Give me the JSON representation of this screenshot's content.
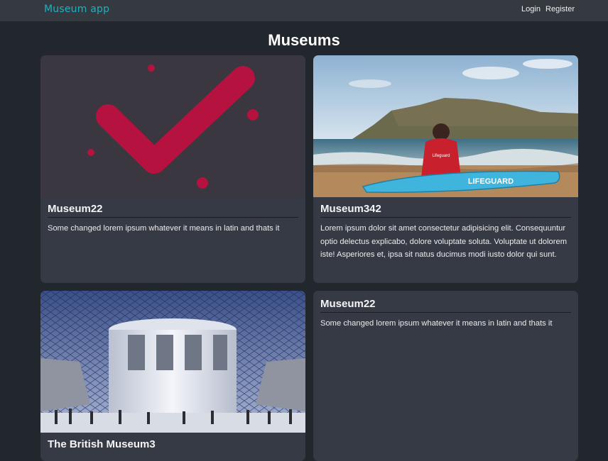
{
  "navbar": {
    "brand": "Museum app",
    "login_label": "Login",
    "register_label": "Register"
  },
  "page_title": "Museums",
  "cards": [
    {
      "image": "checkmark-logo-image",
      "title": "Museum22",
      "description": "Some changed lorem ipsum whatever it means in latin and thats it"
    },
    {
      "image": "lifeguard-beach-photo",
      "title": "Museum342",
      "description": "Lorem ipsum dolor sit amet consectetur adipisicing elit. Consequuntur optio delectus explicabo, dolore voluptate soluta. Voluptate ut dolorem iste! Asperiores et, ipsa sit natus ducimus modi iusto dolor qui sunt.",
      "image_text": {
        "board": "LIFEGUARD",
        "shirt": "Lifeguard"
      }
    },
    {
      "image": "british-museum-great-court-photo",
      "title": "The British Museum3",
      "description": ""
    },
    {
      "title": "Museum22",
      "description": "Some changed lorem ipsum whatever it means in latin and thats it"
    }
  ]
}
